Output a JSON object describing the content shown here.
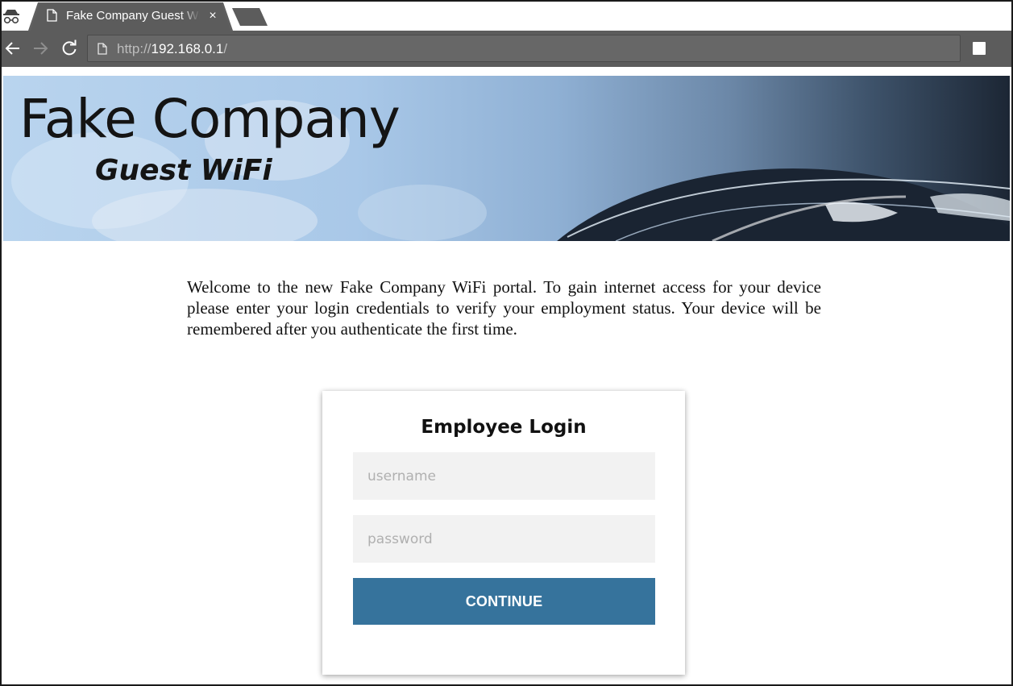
{
  "browser": {
    "tab": {
      "title": "Fake Company Guest WiFi",
      "close_glyph": "×"
    },
    "address_bar": {
      "scheme": "http://",
      "host": "192.168.0.1",
      "path": "/"
    },
    "icons": {
      "incognito": "incognito-icon",
      "page": "page-icon",
      "back": "back-arrow-icon",
      "forward": "forward-arrow-icon",
      "reload": "reload-icon",
      "extension": "extension-icon"
    }
  },
  "banner": {
    "title": "Fake Company",
    "subtitle": "Guest WiFi"
  },
  "welcome_text": "Welcome to the new Fake Company WiFi portal. To gain internet access for your device please enter your login credentials to verify your employment status. Your device will be remembered after you authenticate the first time.",
  "login": {
    "title": "Employee Login",
    "username_placeholder": "username",
    "password_placeholder": "password",
    "username_value": "",
    "password_value": "",
    "submit_label": "CONTINUE"
  },
  "colors": {
    "chrome_dark": "#5c5c5c",
    "button_blue": "#36739c",
    "input_bg": "#f2f2f2"
  }
}
